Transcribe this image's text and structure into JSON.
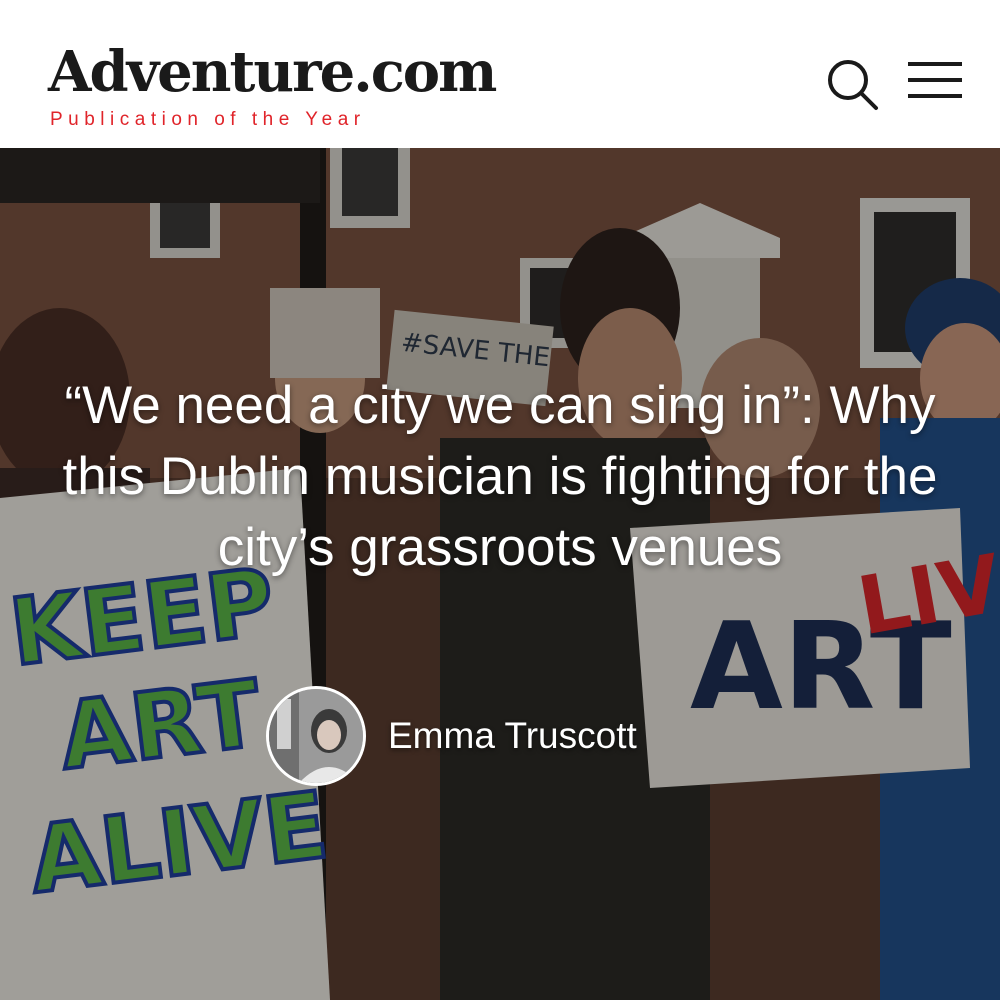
{
  "header": {
    "logo_text": "Adventure.com",
    "tagline": "Publication of the Year",
    "search_icon": "search-icon",
    "menu_icon": "hamburger-menu-icon",
    "logo_color": "#1a1a1a",
    "tagline_color": "#e0242a"
  },
  "hero": {
    "headline": "“We need a city we can sing in”: Why this Dublin musician is fighting for the city’s grassroots venues",
    "author": {
      "name": "Emma Truscott",
      "avatar_icon": "author-avatar"
    },
    "placard_main": [
      "KEEP",
      "ART",
      "ALIVE"
    ],
    "placard_save": "#SAVE THE",
    "placard_right": "LIV",
    "banner_text": "ART"
  }
}
